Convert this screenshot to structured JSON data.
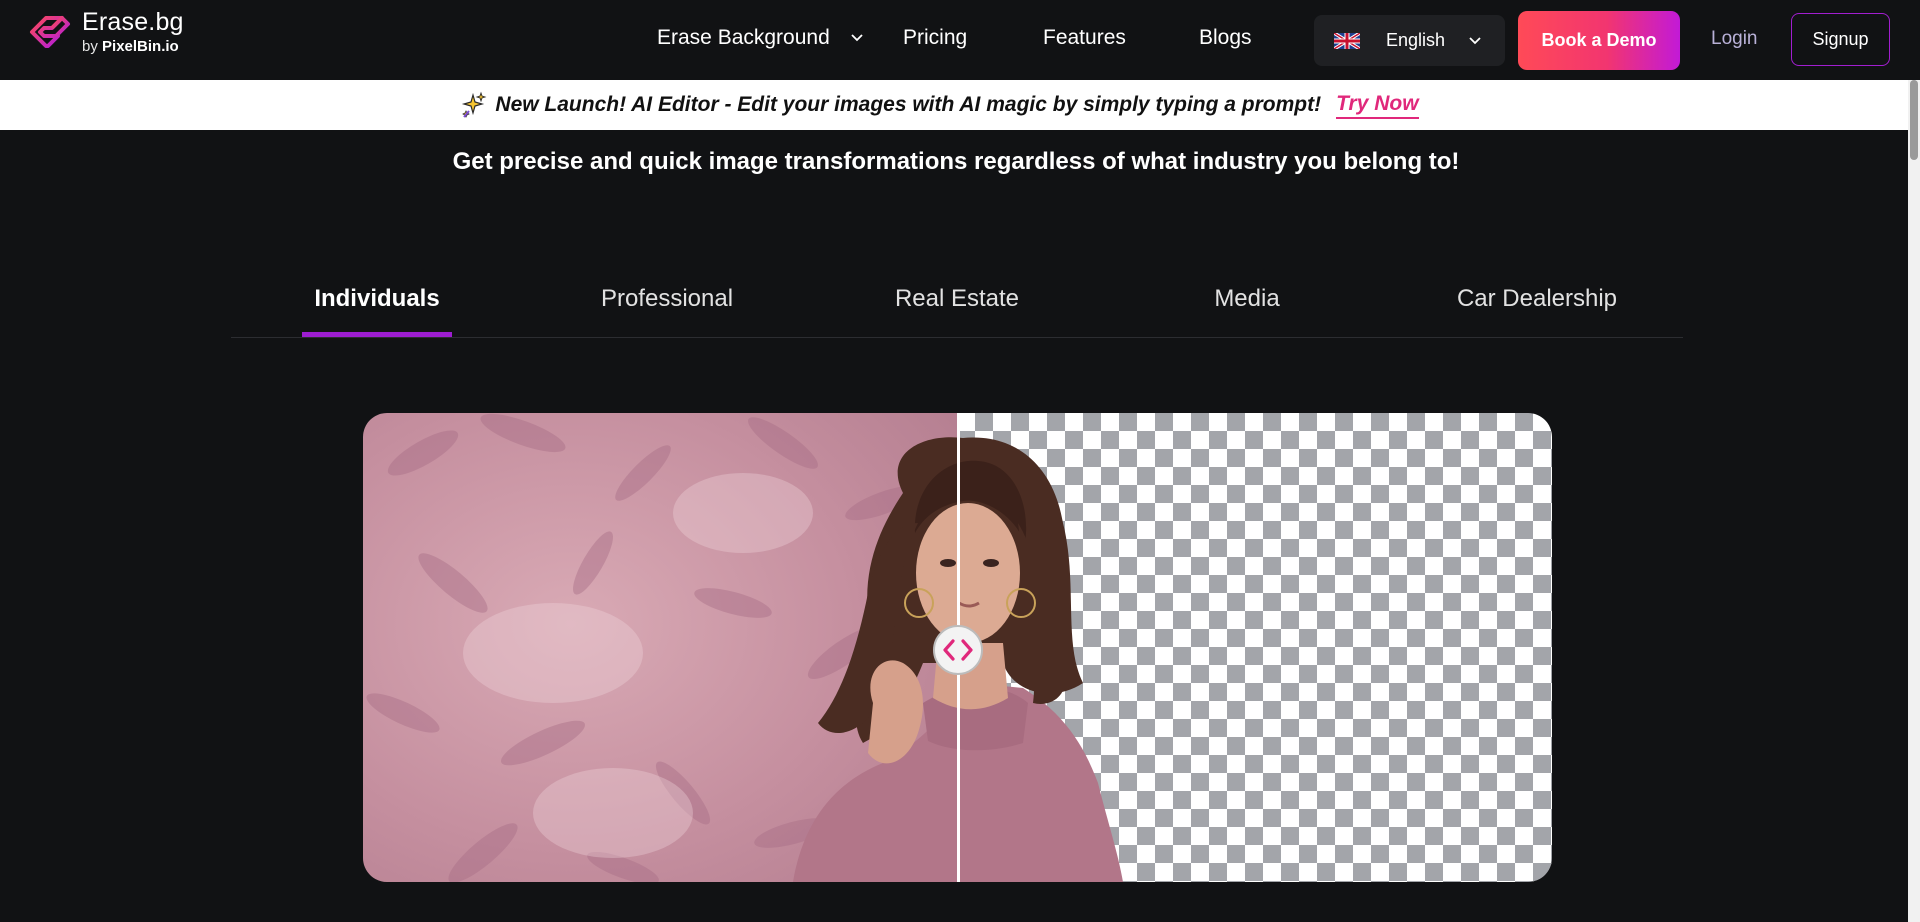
{
  "brand": {
    "title": "Erase.bg",
    "byline_prefix": "by",
    "byline_brand": "PixelBin.io",
    "accent_gradient": [
      "#ff4a57",
      "#c21ad7"
    ]
  },
  "nav": {
    "items": [
      {
        "label": "Erase Background",
        "has_dropdown": true
      },
      {
        "label": "Pricing",
        "has_dropdown": false
      },
      {
        "label": "Features",
        "has_dropdown": false
      },
      {
        "label": "Blogs",
        "has_dropdown": false
      }
    ],
    "language": {
      "flag": "uk-flag-icon",
      "label": "English"
    },
    "book_demo_label": "Book a Demo",
    "login_label": "Login",
    "signup_label": "Signup"
  },
  "announcement": {
    "icon": "sparkle-icon",
    "text": "New Launch! AI Editor - Edit your images with AI magic by simply typing a prompt!",
    "cta_label": "Try Now",
    "cta_color": "#e0287b"
  },
  "main": {
    "headline": "Get precise and quick image transformations regardless of what industry you belong to!",
    "tabs": [
      {
        "label": "Individuals",
        "active": true
      },
      {
        "label": "Professional",
        "active": false
      },
      {
        "label": "Real Estate",
        "active": false
      },
      {
        "label": "Media",
        "active": false
      },
      {
        "label": "Car Dealership",
        "active": false
      }
    ],
    "tab_accent": "#9d1dd1",
    "compare": {
      "before_label": "original-photo",
      "after_label": "background-removed",
      "slider_position_fraction": 0.5
    }
  }
}
